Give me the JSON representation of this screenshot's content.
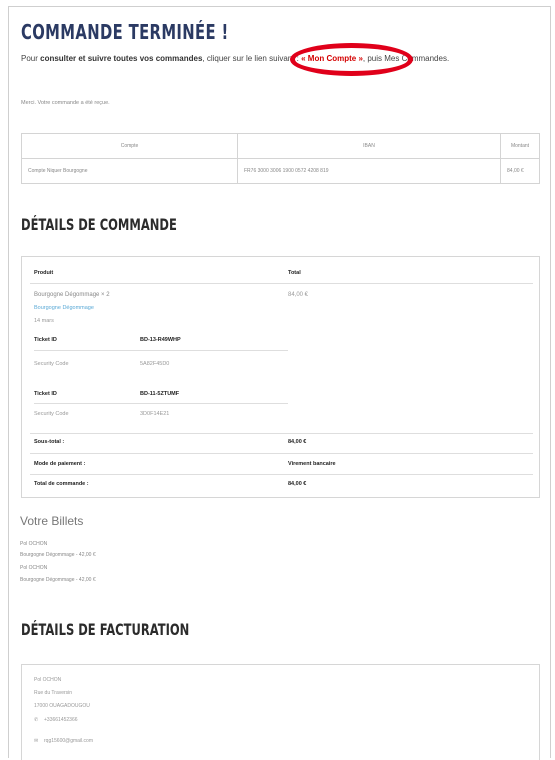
{
  "page": {
    "title": "COMMANDE TERMINÉE !",
    "intro": {
      "prefix": "Pour ",
      "bold": "consulter et suivre toutes vos commandes",
      "middle": ", cliquer sur le lien suivant : ",
      "link": "« Mon Compte »",
      "suffix": ", puis Mes Commandes."
    },
    "thanks": "Merci. Votre commande a été reçue.",
    "accent_colors": {
      "title": "#2b3a63",
      "circle": "#e0001a",
      "link": "#d40000"
    }
  },
  "account_table": {
    "headers": [
      "Compte",
      "IBAN",
      "Montant"
    ],
    "row": [
      "Compte Niquer Bourgogne",
      "FR76 3000 3006 1900 0572 4208 819",
      "84,00 €"
    ]
  },
  "order": {
    "heading": "DÉTAILS DE COMMANDE",
    "col_product": "Produit",
    "col_total": "Total",
    "product_name": "Bourgogne Dégommage × 2",
    "product_total": "84,00 €",
    "product_link": "Bourgogne Dégommage",
    "product_date": "14 mars",
    "tickets": [
      {
        "label": "Ticket ID",
        "id": "BD-13-R49WHP",
        "code_label": "Security Code",
        "code": "5A82F45D0"
      },
      {
        "label": "Ticket ID",
        "id": "BD-11-5ZTUMF",
        "code_label": "Security Code",
        "code": "3D0F14E21"
      }
    ],
    "summary": [
      {
        "label": "Sous-total :",
        "value": "84,00 €"
      },
      {
        "label": "Mode de paiement :",
        "value": "Virement bancaire"
      },
      {
        "label": "Total de commande :",
        "value": "84,00 €"
      }
    ]
  },
  "billets": {
    "heading": "Votre Billets",
    "lines": [
      "Pol OCHON",
      "Bourgogne Dégommage - 42,00 €",
      "Pol OCHON",
      "Bourgogne Dégommage - 42,00 €"
    ]
  },
  "billing": {
    "heading": "DÉTAILS DE FACTURATION",
    "name": "Pol OCHON",
    "street": "Rue du Traversin",
    "city": "17000 OUAGADOUGOU",
    "phone": "+33661452366",
    "email": "rqg15600@gmail.com",
    "phone_icon": "phone-icon",
    "email_icon": "envelope-icon"
  }
}
